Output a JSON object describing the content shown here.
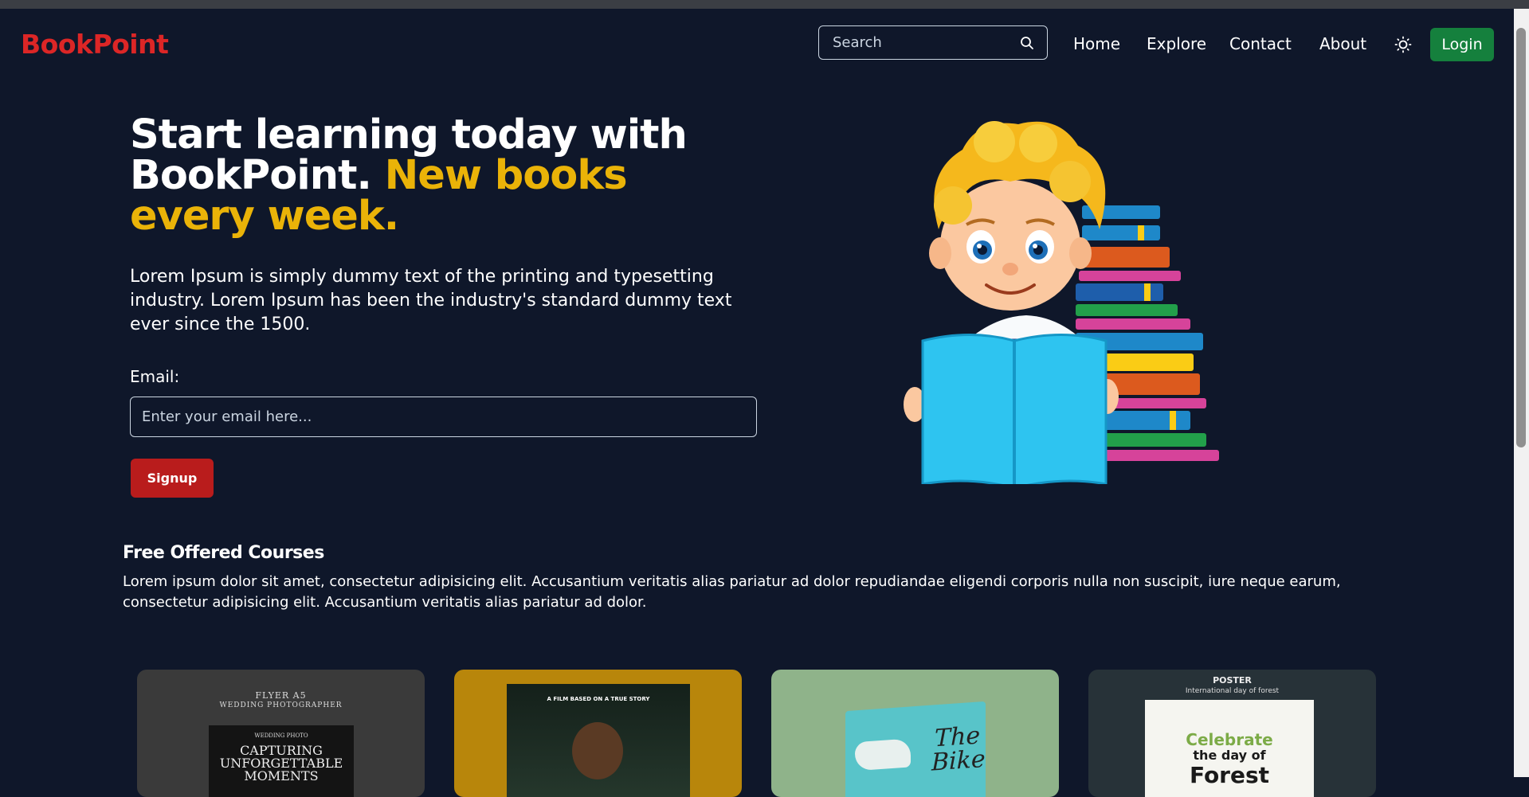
{
  "nav": {
    "logo": "BookPoint",
    "search_placeholder": "Search",
    "links": [
      "Home",
      "Explore",
      "Contact",
      "About"
    ],
    "login_label": "Login"
  },
  "hero": {
    "title_plain": "Start learning today with BookPoint.",
    "title_accent": "New books every week.",
    "description": "Lorem Ipsum is simply dummy text of the printing and typesetting industry. Lorem Ipsum has been the industry's standard dummy text ever since the 1500.",
    "email_label": "Email:",
    "email_placeholder": "Enter your email here...",
    "signup_label": "Signup"
  },
  "courses": {
    "title": "Free Offered Courses",
    "description": "Lorem ipsum dolor sit amet, consectetur adipisicing elit. Accusantium veritatis alias pariatur ad dolor repudiandae eligendi corporis nulla non suscipit, iure neque earum, consectetur adipisicing elit. Accusantium veritatis alias pariatur ad dolor.",
    "cards": [
      {
        "line1": "FLYER A5",
        "line2": "WEDDING PHOTOGRAPHER",
        "line3": "WEDDING PHOTO",
        "line4": "CAPTURING",
        "line5": "UNFORGETTABLE",
        "line6": "MOMENTS"
      },
      {
        "line1": "A FILM BASED ON A TRUE STORY"
      },
      {
        "line1": "The",
        "line2": "Bike"
      },
      {
        "line1": "POSTER",
        "line2": "International day of forest",
        "line3": "Celebrate",
        "line4": "the day of",
        "line5": "Forest"
      }
    ]
  },
  "colors": {
    "background": "#0f172a",
    "logo": "#dc2626",
    "accent": "#eab308",
    "login": "#15803d",
    "signup": "#b91c1c"
  }
}
